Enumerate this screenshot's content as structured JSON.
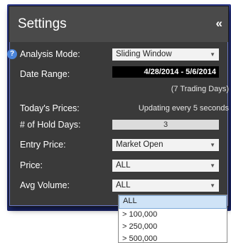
{
  "header": {
    "title": "Settings",
    "collapse_glyph": "«"
  },
  "analysis_mode": {
    "label": "Analysis Mode:",
    "value": "Sliding Window",
    "icon": "help-icon"
  },
  "date_range": {
    "label": "Date Range:",
    "value": "4/28/2014 - 5/6/2014",
    "note": "(7 Trading Days)"
  },
  "todays_prices": {
    "label": "Today's Prices:",
    "value": "Updating every 5 seconds"
  },
  "hold_days": {
    "label": "# of Hold Days:",
    "value": "3"
  },
  "entry_price": {
    "label": "Entry Price:",
    "value": "Market Open"
  },
  "price": {
    "label": "Price:",
    "value": "ALL"
  },
  "avg_volume": {
    "label": "Avg Volume:",
    "value": "ALL",
    "options": [
      "ALL",
      "> 100,000",
      "> 250,000",
      "> 500,000"
    ]
  },
  "colors": {
    "panel": "#3a3a3a",
    "header": "#4a4a4a",
    "accent_frame": "#2d3a8f",
    "help_icon": "#4b84d9"
  }
}
